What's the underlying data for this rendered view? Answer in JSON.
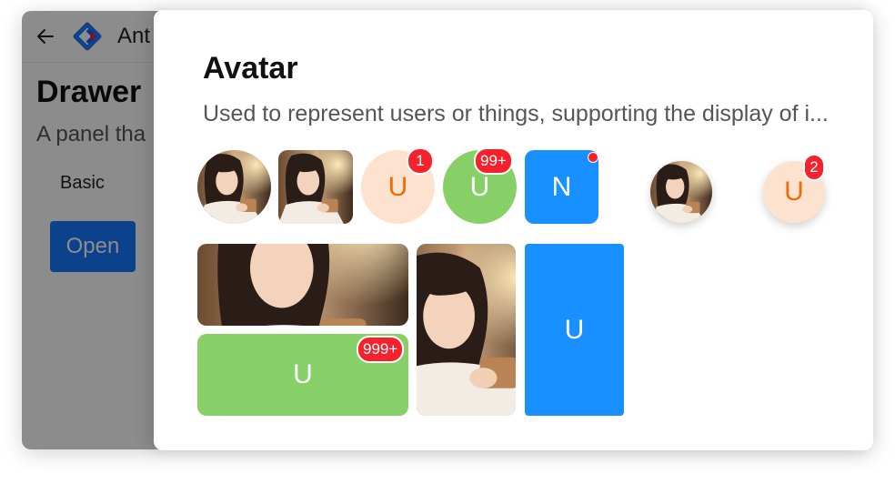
{
  "app": {
    "title": "Ant",
    "page_title": "Drawer",
    "page_desc": "A panel tha",
    "section_label": "Basic",
    "open_button": "Open"
  },
  "drawer": {
    "title": "Avatar",
    "description": "Used to represent users or things, supporting the display of i..."
  },
  "avatars": {
    "u_letter": "U",
    "n_letter": "N",
    "badge_1": "1",
    "badge_99": "99+",
    "badge_2": "2",
    "badge_999": "999+"
  },
  "colors": {
    "peach_bg": "#fde3cf",
    "peach_fg": "#f56a00",
    "green": "#87d068",
    "blue": "#1890ff",
    "badge_red": "#f5222d"
  }
}
